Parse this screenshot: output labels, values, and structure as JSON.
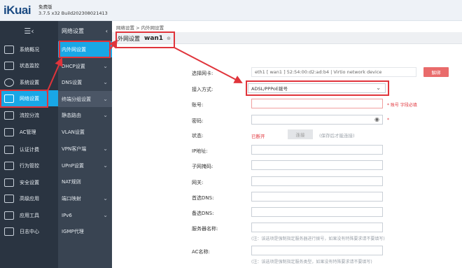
{
  "header": {
    "logo_text": "iKuai",
    "edition": "免费版",
    "version": "3.7.5 x32 Build202308021413"
  },
  "sidebar": {
    "collapse_glyph": "☰‹",
    "items": [
      {
        "label": "系统概况",
        "icon": "gauge-icon"
      },
      {
        "label": "状态监控",
        "icon": "monitor-icon"
      },
      {
        "label": "系统设置",
        "icon": "gear-icon"
      },
      {
        "label": "网络设置",
        "icon": "network-icon"
      },
      {
        "label": "流控分流",
        "icon": "flow-icon"
      },
      {
        "label": "AC管理",
        "icon": "ac-icon"
      },
      {
        "label": "认证计费",
        "icon": "auth-icon"
      },
      {
        "label": "行为管控",
        "icon": "control-icon"
      },
      {
        "label": "安全设置",
        "icon": "shield-icon"
      },
      {
        "label": "高级应用",
        "icon": "app-icon"
      },
      {
        "label": "应用工具",
        "icon": "tools-icon"
      },
      {
        "label": "日志中心",
        "icon": "log-icon"
      }
    ]
  },
  "subnav": {
    "title": "网络设置",
    "items": [
      {
        "label": "内外网设置",
        "chev": ""
      },
      {
        "label": "DHCP设置",
        "chev": "⌄"
      },
      {
        "label": "DNS设置",
        "chev": "⌄"
      },
      {
        "label": "终端分组设置",
        "chev": "⌄"
      },
      {
        "label": "静态路由",
        "chev": "⌄"
      },
      {
        "label": "VLAN设置",
        "chev": ""
      },
      {
        "label": "VPN客户端",
        "chev": "⌄"
      },
      {
        "label": "UPnP设置",
        "chev": "⌄"
      },
      {
        "label": "NAT规则",
        "chev": ""
      },
      {
        "label": "端口映射",
        "chev": "⌄"
      },
      {
        "label": "IPv6",
        "chev": "⌄"
      },
      {
        "label": "IGMP代理",
        "chev": ""
      }
    ]
  },
  "breadcrumb": "网络设置 > 内外网设置",
  "tab": {
    "label": "外网设置",
    "name": "wan1",
    "plus": "⊕"
  },
  "form": {
    "nic_label": "选择网卡:",
    "nic_value": "eth1 [ wan1 ] 52:54:00:d2:ad:b4 | Virtio network device",
    "unbind_label": "解绑",
    "access_label": "接入方式:",
    "access_value": "ADSL/PPPoE拨号",
    "account_label": "账号:",
    "account_hint": "* 账号 字段必填",
    "password_label": "密码:",
    "password_hint": "*",
    "status_label": "状态:",
    "status_value": "已断开",
    "connect_label": "连接",
    "connect_note": "(保存后才能连接)",
    "ip_label": "IP地址:",
    "mask_label": "子网掩码:",
    "gateway_label": "网关:",
    "dns1_label": "首选DNS:",
    "dns2_label": "备选DNS:",
    "server_label": "服务器名称:",
    "server_note": "(注：该选项是强制指定服务器进行拨号，如果没有特殊要求请不要填写)",
    "ac_label": "AC名称:",
    "ac_note": "(注：该选项是强制指定服务类型，如果没有特殊要求请不要填写)"
  },
  "colors": {
    "accent": "#19a7e6",
    "highlight": "#e0343b",
    "sidebar": "#2a3441",
    "subnav": "#394452"
  }
}
